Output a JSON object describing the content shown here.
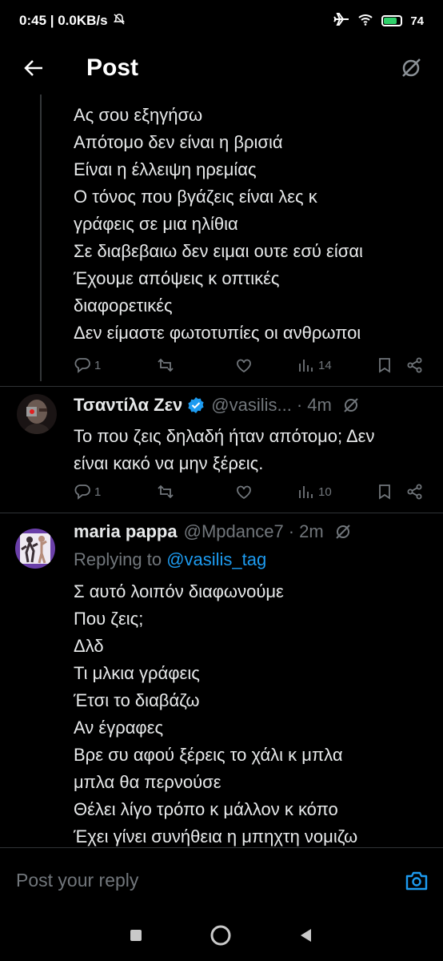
{
  "status": {
    "time_speed": "0:45 | 0.0KB/s",
    "battery": "74"
  },
  "header": {
    "title": "Post"
  },
  "tweet1": {
    "text": "Ας σου εξηγήσω\nΑπότομο δεν είναι η βρισιά\nΕίναι η έλλειψη ηρεμίας\nΟ τόνος που βγάζεις είναι λες κ\nγράφεις σε μια ηλίθια\nΣε διαβεβαιω δεν ειμαι ουτε εσύ είσαι\nΈχουμε απόψεις κ οπτικές\nδιαφορετικές\nΔεν είμαστε φωτοτυπίες οι ανθρωποι",
    "replies": "1",
    "views": "14"
  },
  "tweet2": {
    "name": "Τσαντίλα Ζεν",
    "handle": "@vasilis...",
    "time": "· 4m",
    "text": "Το που ζεις δηλαδή ήταν απότομο; Δεν\nείναι κακό να μην ξέρεις.",
    "replies": "1",
    "views": "10"
  },
  "tweet3": {
    "name": "maria pappa",
    "handle": "@Mpdance7",
    "time": "· 2m",
    "replying_prefix": "Replying to ",
    "replying_to": "@vasilis_tag",
    "text": "Σ αυτό λοιπόν διαφωνούμε\nΠου ζεις;\nΔλδ\nΤι μλκια γράφεις\nΈτσι το διαβάζω\nΑν έγραφες\nΒρε συ αφού ξέρεις το χάλι κ μπλα\nμπλα θα περνούσε\nΘέλει λίγο τρόπο κ μάλλον κ κόπο\nΈχει γίνει συνήθεια η μπηχτη νομιζω"
  },
  "composer": {
    "placeholder": "Post your reply"
  },
  "colors": {
    "accent": "#1d9bf0",
    "muted": "#71767b",
    "text": "#e7e9ea"
  }
}
